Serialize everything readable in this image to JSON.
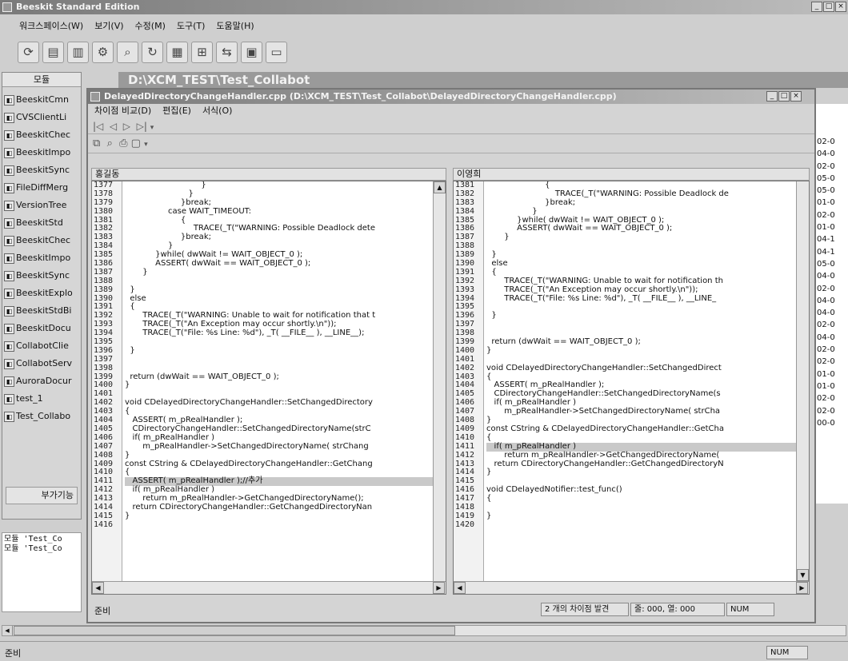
{
  "main": {
    "title": "Beeskit Standard Edition",
    "menu": [
      "워크스페이스(W)",
      "보기(V)",
      "수정(M)",
      "도구(T)",
      "도움말(H)"
    ],
    "toolbar_icons": [
      "workspace-icon",
      "compare-icon",
      "compare-folder-icon",
      "connect-icon",
      "find-icon",
      "refresh-icon",
      "grid-icon",
      "tree-icon",
      "merge-icon",
      "report-icon",
      "window-icon"
    ],
    "sidebar_header": "모듈",
    "sidebar_items": [
      "BeeskitCmn",
      "CVSClientLi",
      "BeeskitChec",
      "BeeskitImpo",
      "BeeskitSync",
      "FileDiffMerg",
      "VersionTree",
      "BeeskitStd",
      "BeeskitChec",
      "BeeskitImpo",
      "BeeskitSync",
      "BeeskitExplo",
      "BeeskitStdBi",
      "BeeskitDocu",
      "CollabotClie",
      "CollabotServ",
      "AuroraDocur",
      "test_1",
      "Test_Collabo"
    ],
    "sidebar_footer": "부가기능",
    "output_lines": [
      "모듈  'Test_Co",
      "모듈  'Test_Co"
    ],
    "path_title": "D:\\XCM_TEST\\Test_Collabot",
    "status_ready": "준비",
    "status_num": "NUM",
    "right_column": [
      "02-0",
      "04-0",
      "02-0",
      "05-0",
      "05-0",
      "01-0",
      "02-0",
      "01-0",
      "04-1",
      "04-1",
      "05-0",
      "04-0",
      "02-0",
      "04-0",
      "04-0",
      "02-0",
      "04-0",
      "02-0",
      "02-0",
      "01-0",
      "01-0",
      "02-0",
      "02-0",
      "00-0"
    ]
  },
  "diff": {
    "title": "DelayedDirectoryChangeHandler.cpp (D:\\XCM_TEST\\Test_Collabot\\DelayedDirectoryChangeHandler.cpp)",
    "menu": [
      "차이점 비교(D)",
      "편집(E)",
      "서식(O)"
    ],
    "left_header": "홍길동",
    "right_header": "이영희",
    "left_lines": [
      {
        "n": "1377",
        "t": "                              }"
      },
      {
        "n": "1378",
        "t": "                         }"
      },
      {
        "n": "1379",
        "t": "                      }break;"
      },
      {
        "n": "1380",
        "t": "                 case WAIT_TIMEOUT:"
      },
      {
        "n": "1381",
        "t": "                      {"
      },
      {
        "n": "1382",
        "t": "                           TRACE(_T(\"WARNING: Possible Deadlock dete"
      },
      {
        "n": "1383",
        "t": "                      }break;"
      },
      {
        "n": "1384",
        "t": "                 }"
      },
      {
        "n": "1385",
        "t": "            }while( dwWait != WAIT_OBJECT_0 );"
      },
      {
        "n": "1386",
        "t": "            ASSERT( dwWait == WAIT_OBJECT_0 );"
      },
      {
        "n": "1387",
        "t": "       }"
      },
      {
        "n": "1388",
        "t": ""
      },
      {
        "n": "1389",
        "t": "  }"
      },
      {
        "n": "1390",
        "t": "  else"
      },
      {
        "n": "1391",
        "t": "  {"
      },
      {
        "n": "1392",
        "t": "       TRACE(_T(\"WARNING: Unable to wait for notification that t"
      },
      {
        "n": "1393",
        "t": "       TRACE(_T(\"An Exception may occur shortly.\\n\"));"
      },
      {
        "n": "1394",
        "t": "       TRACE(_T(\"File: %s Line: %d\"), _T( __FILE__ ), __LINE__);"
      },
      {
        "n": "1395",
        "t": ""
      },
      {
        "n": "1396",
        "t": "  }"
      },
      {
        "n": "1397",
        "t": ""
      },
      {
        "n": "1398",
        "t": ""
      },
      {
        "n": "1399",
        "t": "  return (dwWait == WAIT_OBJECT_0 );"
      },
      {
        "n": "1400",
        "t": "}"
      },
      {
        "n": "1401",
        "t": ""
      },
      {
        "n": "1402",
        "t": "void CDelayedDirectoryChangeHandler::SetChangedDirectory"
      },
      {
        "n": "1403",
        "t": "{"
      },
      {
        "n": "1404",
        "t": "   ASSERT( m_pRealHandler );"
      },
      {
        "n": "1405",
        "t": "   CDirectoryChangeHandler::SetChangedDirectoryName(strC"
      },
      {
        "n": "1406",
        "t": "   if( m_pRealHandler )"
      },
      {
        "n": "1407",
        "t": "       m_pRealHandler->SetChangedDirectoryName( strChang"
      },
      {
        "n": "1408",
        "t": "}"
      },
      {
        "n": "1409",
        "t": "const CString & CDelayedDirectoryChangeHandler::GetChang"
      },
      {
        "n": "1410",
        "t": "{"
      },
      {
        "n": "1411",
        "t": "   ASSERT( m_pRealHandler );//추가",
        "h": true
      },
      {
        "n": "1412",
        "t": "   if( m_pRealHandler )"
      },
      {
        "n": "1413",
        "t": "       return m_pRealHandler->GetChangedDirectoryName();"
      },
      {
        "n": "1414",
        "t": "   return CDirectoryChangeHandler::GetChangedDirectoryNan"
      },
      {
        "n": "1415",
        "t": "}"
      },
      {
        "n": "1416",
        "t": ""
      }
    ],
    "right_lines": [
      {
        "n": "1381",
        "t": "                       {"
      },
      {
        "n": "1382",
        "t": "                           TRACE(_T(\"WARNING: Possible Deadlock de"
      },
      {
        "n": "1383",
        "t": "                       }break;"
      },
      {
        "n": "1384",
        "t": "                  }"
      },
      {
        "n": "1385",
        "t": "            }while( dwWait != WAIT_OBJECT_0 );"
      },
      {
        "n": "1386",
        "t": "            ASSERT( dwWait == WAIT_OBJECT_0 );"
      },
      {
        "n": "1387",
        "t": "       }"
      },
      {
        "n": "1388",
        "t": ""
      },
      {
        "n": "1389",
        "t": "  }"
      },
      {
        "n": "1390",
        "t": "  else"
      },
      {
        "n": "1391",
        "t": "  {"
      },
      {
        "n": "1392",
        "t": "       TRACE(_T(\"WARNING: Unable to wait for notification th"
      },
      {
        "n": "1393",
        "t": "       TRACE(_T(\"An Exception may occur shortly.\\n\"));"
      },
      {
        "n": "1394",
        "t": "       TRACE(_T(\"File: %s Line: %d\"), _T( __FILE__ ), __LINE_"
      },
      {
        "n": "1395",
        "t": ""
      },
      {
        "n": "1396",
        "t": "  }"
      },
      {
        "n": "1397",
        "t": ""
      },
      {
        "n": "1398",
        "t": ""
      },
      {
        "n": "1399",
        "t": "  return (dwWait == WAIT_OBJECT_0 );"
      },
      {
        "n": "1400",
        "t": "}"
      },
      {
        "n": "1401",
        "t": ""
      },
      {
        "n": "1402",
        "t": "void CDelayedDirectoryChangeHandler::SetChangedDirect"
      },
      {
        "n": "1403",
        "t": "{"
      },
      {
        "n": "1404",
        "t": "   ASSERT( m_pRealHandler );"
      },
      {
        "n": "1405",
        "t": "   CDirectoryChangeHandler::SetChangedDirectoryName(s"
      },
      {
        "n": "1406",
        "t": "   if( m_pRealHandler )"
      },
      {
        "n": "1407",
        "t": "       m_pRealHandler->SetChangedDirectoryName( strCha"
      },
      {
        "n": "1408",
        "t": "}"
      },
      {
        "n": "1409",
        "t": "const CString & CDelayedDirectoryChangeHandler::GetCha"
      },
      {
        "n": "1410",
        "t": "{"
      },
      {
        "n": "1411",
        "t": "   if( m_pRealHandler )",
        "h": true
      },
      {
        "n": "1412",
        "t": "       return m_pRealHandler->GetChangedDirectoryName("
      },
      {
        "n": "1413",
        "t": "   return CDirectoryChangeHandler::GetChangedDirectoryN"
      },
      {
        "n": "1414",
        "t": "}"
      },
      {
        "n": "1415",
        "t": ""
      },
      {
        "n": "1416",
        "t": "void CDelayedNotifier::test_func()"
      },
      {
        "n": "1417",
        "t": "{"
      },
      {
        "n": "1418",
        "t": ""
      },
      {
        "n": "1419",
        "t": "}"
      },
      {
        "n": "1420",
        "t": ""
      }
    ],
    "status_ready": "준비",
    "diff_count": "2 개의 차이점 발견",
    "position": "줄: 000, 열: 000",
    "num": "NUM"
  }
}
